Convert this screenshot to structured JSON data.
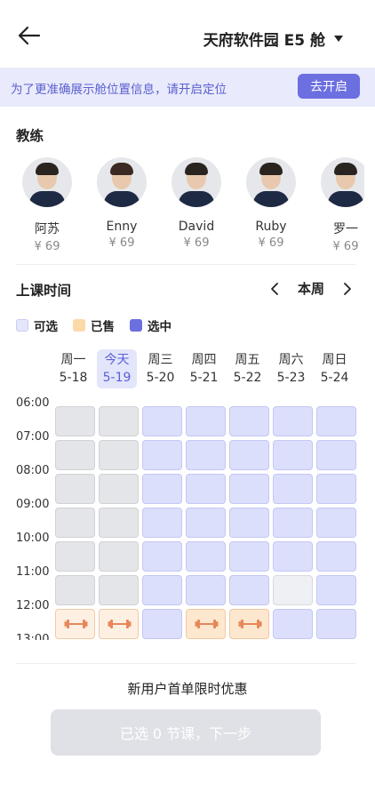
{
  "header": {
    "back_icon": "arrow-left-icon",
    "cabin_name": "天府软件园 E5 舱",
    "dropdown_icon": "caret-down-icon"
  },
  "location_banner": {
    "text": "为了更准确展示舱位置信息，请开启定位",
    "button_label": "去开启",
    "accent_color": "#6b6fe0"
  },
  "coaches": {
    "title": "教练",
    "items": [
      {
        "name": "阿苏",
        "price": "¥ 69"
      },
      {
        "name": "Enny",
        "price": "¥ 69"
      },
      {
        "name": "David",
        "price": "¥ 69"
      },
      {
        "name": "Ruby",
        "price": "¥ 69"
      },
      {
        "name": "罗一",
        "price": "¥ 69"
      }
    ]
  },
  "schedule": {
    "title": "上课时间",
    "prev_icon": "chevron-left-icon",
    "next_icon": "chevron-right-icon",
    "week_label": "本周",
    "legend": [
      {
        "label": "可选",
        "color": "#e4e7fb"
      },
      {
        "label": "已售",
        "color": "#fbd9a8"
      },
      {
        "label": "选中",
        "color": "#6b6fe0"
      }
    ],
    "days": [
      {
        "weekday": "周一",
        "date": "5-18"
      },
      {
        "weekday": "今天",
        "date": "5-19"
      },
      {
        "weekday": "周三",
        "date": "5-20"
      },
      {
        "weekday": "周四",
        "date": "5-21"
      },
      {
        "weekday": "周五",
        "date": "5-22"
      },
      {
        "weekday": "周六",
        "date": "5-23"
      },
      {
        "weekday": "周日",
        "date": "5-24"
      }
    ],
    "times": [
      "06:00",
      "07:00",
      "08:00",
      "09:00",
      "10:00",
      "11:00",
      "12:00",
      "13:00"
    ],
    "slots": [
      [
        "past",
        "past",
        "avail",
        "avail",
        "avail",
        "avail",
        "avail"
      ],
      [
        "past",
        "past",
        "avail",
        "avail",
        "avail",
        "avail",
        "avail"
      ],
      [
        "past",
        "past",
        "avail",
        "avail",
        "avail",
        "avail",
        "avail"
      ],
      [
        "past",
        "past",
        "avail",
        "avail",
        "avail",
        "avail",
        "avail"
      ],
      [
        "past",
        "past",
        "avail",
        "avail",
        "avail",
        "avail",
        "avail"
      ],
      [
        "past",
        "past",
        "avail",
        "avail",
        "avail",
        "grey",
        "avail"
      ],
      [
        "sold-pale",
        "sold-pale",
        "avail",
        "sold",
        "sold",
        "avail",
        "avail"
      ]
    ],
    "sold_icon": "dumbbell-icon"
  },
  "footer": {
    "promo_text": "新用户首单限时优惠",
    "submit_label": "已选 0 节课，下一步"
  }
}
